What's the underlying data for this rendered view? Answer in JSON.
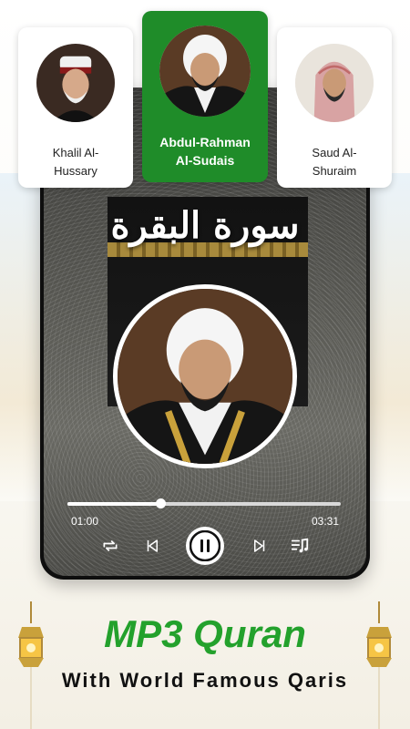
{
  "reciters": [
    {
      "name": "Khalil Al-\nHussary",
      "avatar_icon": "reciter-portrait-icon",
      "selected": false
    },
    {
      "name": "Abdul-Rahman\nAl-Sudais",
      "avatar_icon": "reciter-portrait-icon",
      "selected": true
    },
    {
      "name": "Saud Al-\nShuraim",
      "avatar_icon": "reciter-portrait-icon",
      "selected": false
    }
  ],
  "player": {
    "surah_title": "سورة البقرة",
    "current_time": "01:00",
    "total_time": "03:31",
    "progress_percent": 34,
    "controls": [
      "repeat-icon",
      "previous-icon",
      "pause-icon",
      "next-icon",
      "playlist-icon"
    ]
  },
  "promo": {
    "headline": "MP3 Quran",
    "subline": "With World Famous Qaris"
  },
  "colors": {
    "accent_green": "#1f8c29",
    "headline_green": "#23a12c"
  }
}
